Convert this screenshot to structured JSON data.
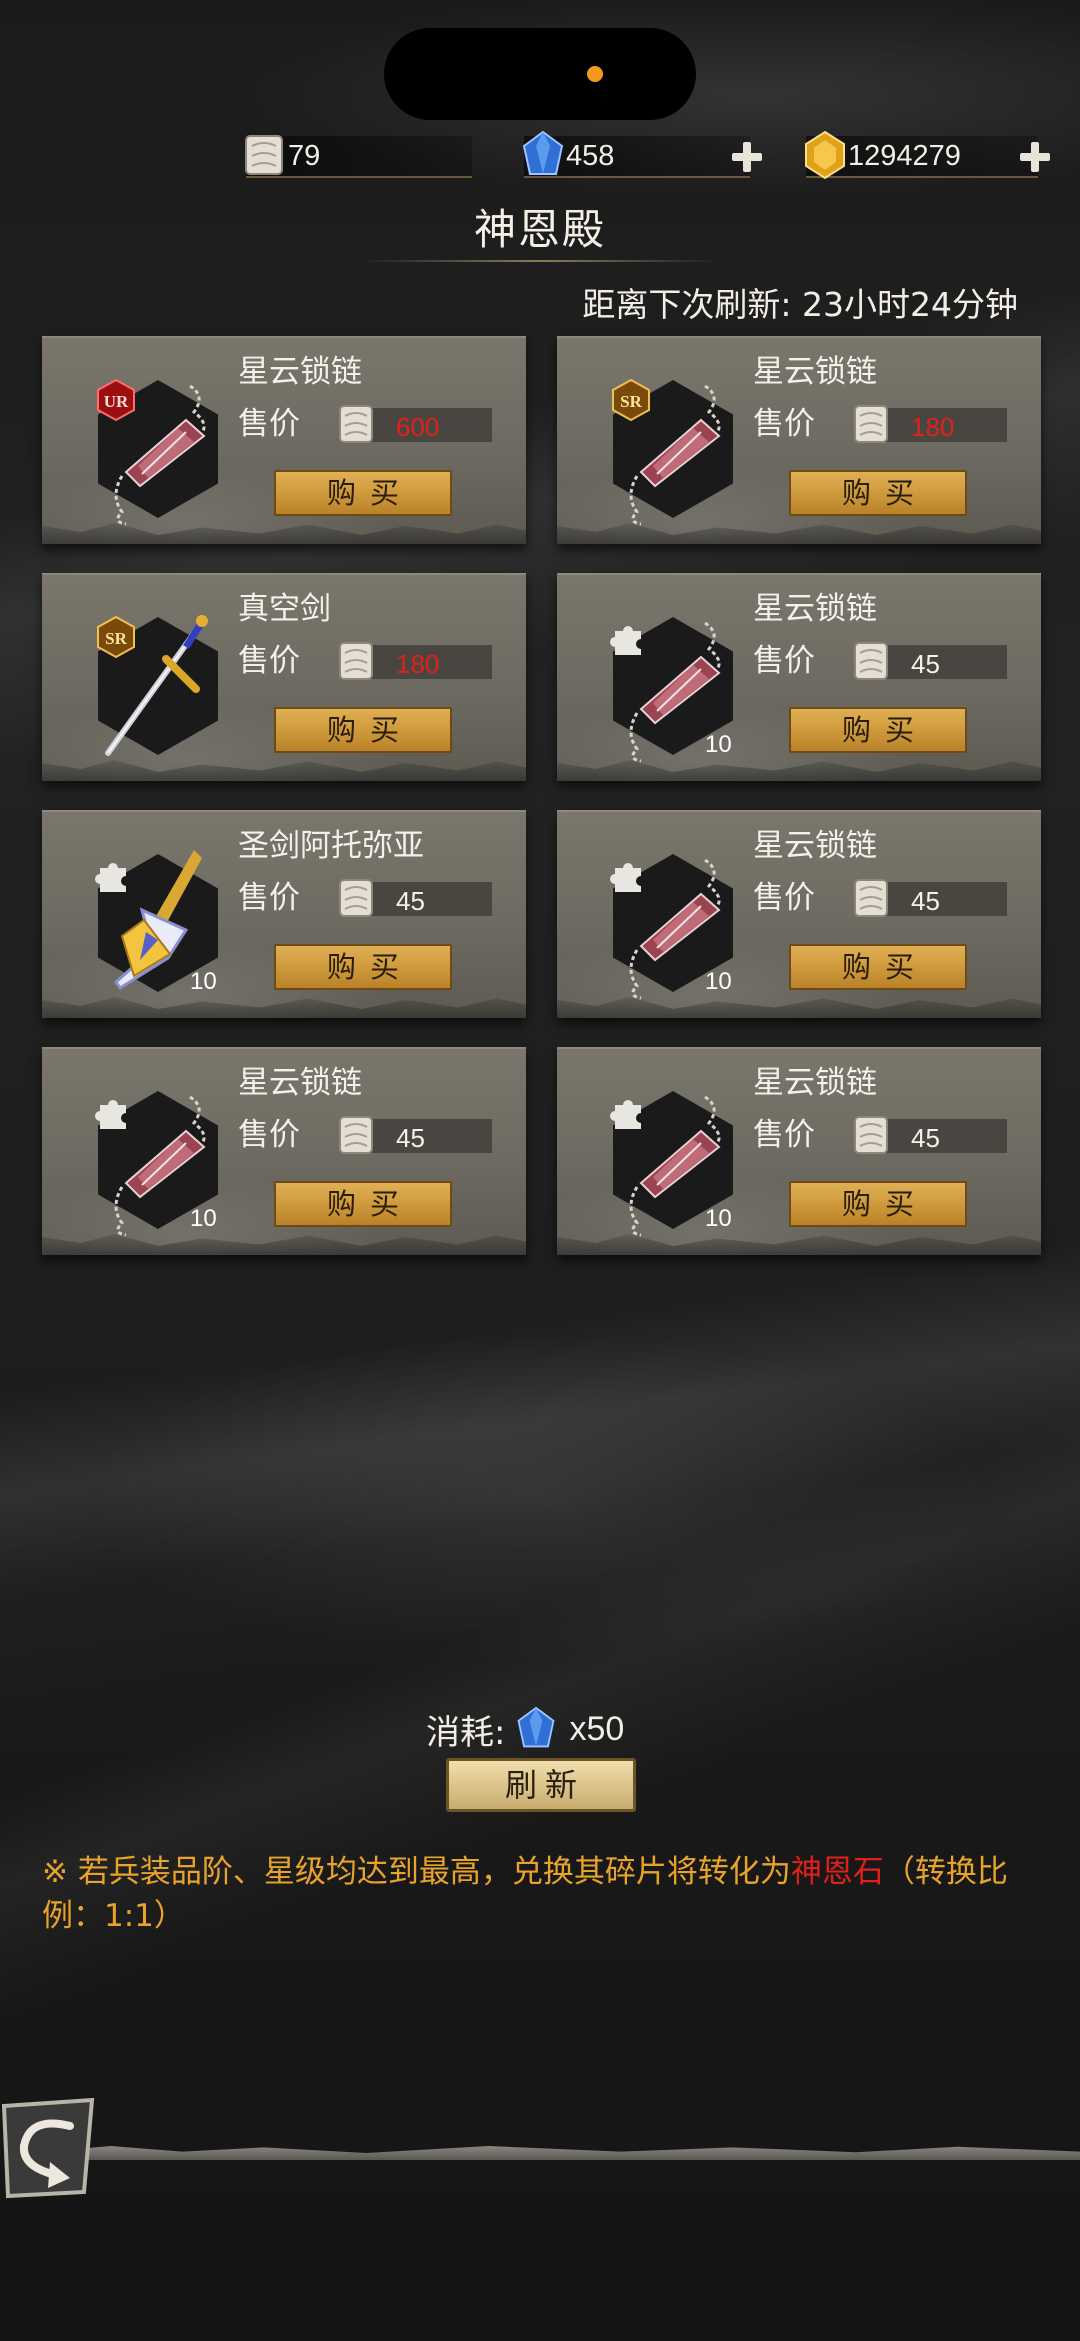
{
  "currency": {
    "scroll_value": "79",
    "gem_value": "458",
    "gold_value": "1294279"
  },
  "header": {
    "title": "神恩殿",
    "refresh_timer": "距离下次刷新: 23小时24分钟"
  },
  "shop": {
    "price_label": "售价",
    "buy_label": "购买",
    "items": [
      {
        "name": "星云锁链",
        "price": "600",
        "price_color": "#e0201a",
        "badge": "UR",
        "count": "",
        "art": "chain-icon"
      },
      {
        "name": "星云锁链",
        "price": "180",
        "price_color": "#e0201a",
        "badge": "SR",
        "count": "",
        "art": "chain-icon"
      },
      {
        "name": "真空剑",
        "price": "180",
        "price_color": "#e0201a",
        "badge": "SR",
        "count": "",
        "art": "sword-icon"
      },
      {
        "name": "星云锁链",
        "price": "45",
        "price_color": "#f4f1ea",
        "badge": "fragment",
        "count": "10",
        "art": "chain-icon"
      },
      {
        "name": "圣剑阿托弥亚",
        "price": "45",
        "price_color": "#f4f1ea",
        "badge": "fragment",
        "count": "10",
        "art": "holy-sword-icon"
      },
      {
        "name": "星云锁链",
        "price": "45",
        "price_color": "#f4f1ea",
        "badge": "fragment",
        "count": "10",
        "art": "chain-icon"
      },
      {
        "name": "星云锁链",
        "price": "45",
        "price_color": "#f4f1ea",
        "badge": "fragment",
        "count": "10",
        "art": "chain-icon"
      },
      {
        "name": "星云锁链",
        "price": "45",
        "price_color": "#f4f1ea",
        "badge": "fragment",
        "count": "10",
        "art": "chain-icon"
      }
    ]
  },
  "footer": {
    "cost_label": "消耗:",
    "cost_amount": "x50",
    "refresh_label": "刷新",
    "note_prefix": "※ 若兵装品阶、星级均达到最高，兑换其碎片将转化为",
    "note_highlight": "神恩石",
    "note_suffix": "（转换比例：1:1）"
  },
  "colors": {
    "accent_gold": "#cf9a3c",
    "price_red": "#e0201a",
    "note_orange": "#e8a42a"
  }
}
